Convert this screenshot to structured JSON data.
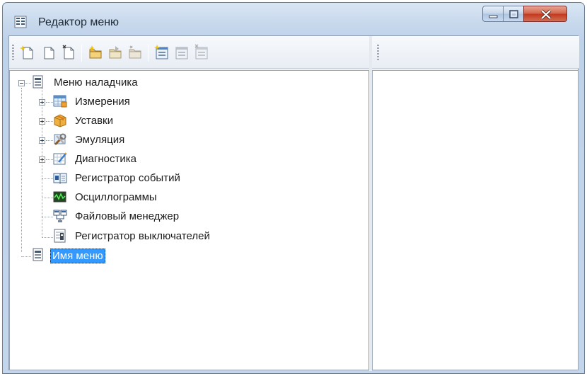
{
  "window": {
    "title": "Редактор меню",
    "icons": {
      "app": "grid-app-icon",
      "minimize": "minimize-icon",
      "maximize": "maximize-icon",
      "close": "close-icon"
    }
  },
  "toolbar": {
    "buttons": [
      {
        "name": "new-item-button",
        "icon": "new-document-sparkle-icon"
      },
      {
        "name": "blank-document-button",
        "icon": "document-icon"
      },
      {
        "name": "document-edit-button",
        "icon": "document-edit-icon"
      },
      {
        "name": "folder-add-button",
        "icon": "folder-sparkle-icon"
      },
      {
        "name": "folder-move-button",
        "icon": "folder-arrow-icon"
      },
      {
        "name": "folder-disabled-button",
        "icon": "folder-gray-icon"
      },
      {
        "name": "form-add-button",
        "icon": "form-sparkle-icon"
      },
      {
        "name": "form-button",
        "icon": "form-icon"
      },
      {
        "name": "form-disabled-button",
        "icon": "form-gray-icon"
      }
    ]
  },
  "tree": {
    "root": {
      "label": "Меню наладчика",
      "icon": "menu-root-icon"
    },
    "items": [
      {
        "label": "Измерения",
        "icon": "measurements-table-icon",
        "expandable": true
      },
      {
        "label": "Уставки",
        "icon": "settings-box-icon",
        "expandable": true
      },
      {
        "label": "Эмуляция",
        "icon": "emulation-tools-icon",
        "expandable": true
      },
      {
        "label": "Диагностика",
        "icon": "diagnostics-chart-icon",
        "expandable": true
      },
      {
        "label": "Регистратор событий",
        "icon": "event-log-book-icon",
        "expandable": false
      },
      {
        "label": "Осциллограммы",
        "icon": "oscillogram-icon",
        "expandable": false
      },
      {
        "label": "Файловый менеджер",
        "icon": "file-manager-icon",
        "expandable": false
      },
      {
        "label": "Регистратор выключателей",
        "icon": "breaker-register-icon",
        "expandable": false
      }
    ],
    "second_root": {
      "label": "Имя меню",
      "icon": "menu-root-icon",
      "selected": true
    }
  },
  "colors": {
    "selection": "#3399ff",
    "close_button": "#c2391f"
  }
}
